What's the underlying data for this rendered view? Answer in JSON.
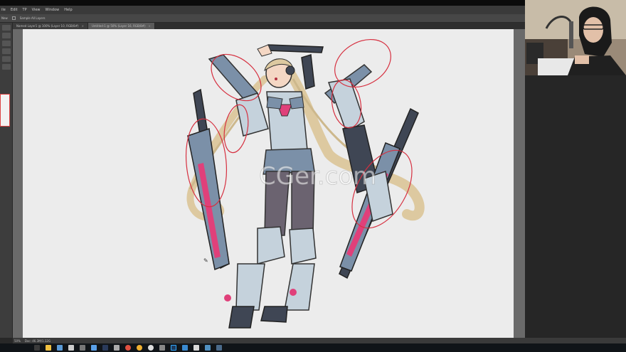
{
  "app": {
    "menu": [
      "ile",
      "Edit",
      "TP",
      "View",
      "Window",
      "Help"
    ]
  },
  "options": {
    "left_label": "New",
    "checkbox_label": "Sample All Layers"
  },
  "tabs": [
    {
      "label": "Named Layer1 @ 100% (Layer 10, RGB/8#)",
      "close": "×",
      "active": false
    },
    {
      "label": "Untitled-1 @ 50% (Layer 16, RGB/8#)",
      "close": "×",
      "active": true
    }
  ],
  "status": {
    "zoom": "50%",
    "doc": "Doc: 46.3M/1.12G"
  },
  "watermark": {
    "text": "CGer.com"
  },
  "colors": {
    "canvas": "#ececec",
    "annotation_red": "#d63040",
    "armor_pink": "#e0407a",
    "armor_blue": "#7b90a8",
    "armor_dark": "#3f4654",
    "armor_light": "#c5d2dc",
    "hair": "#ddc9a0",
    "skin": "#f4d7c4"
  },
  "taskbar": {
    "icons": [
      "start-icon",
      "file-explorer-icon",
      "folder-icon",
      "terminal-icon",
      "media-icon",
      "store-icon",
      "steam-icon",
      "tablet-icon",
      "chrome-icon",
      "chrome-canary-icon",
      "obs-icon",
      "settings-icon",
      "photoshop-icon",
      "notes-icon",
      "app-icon",
      "app2-icon",
      "photos-icon"
    ]
  }
}
